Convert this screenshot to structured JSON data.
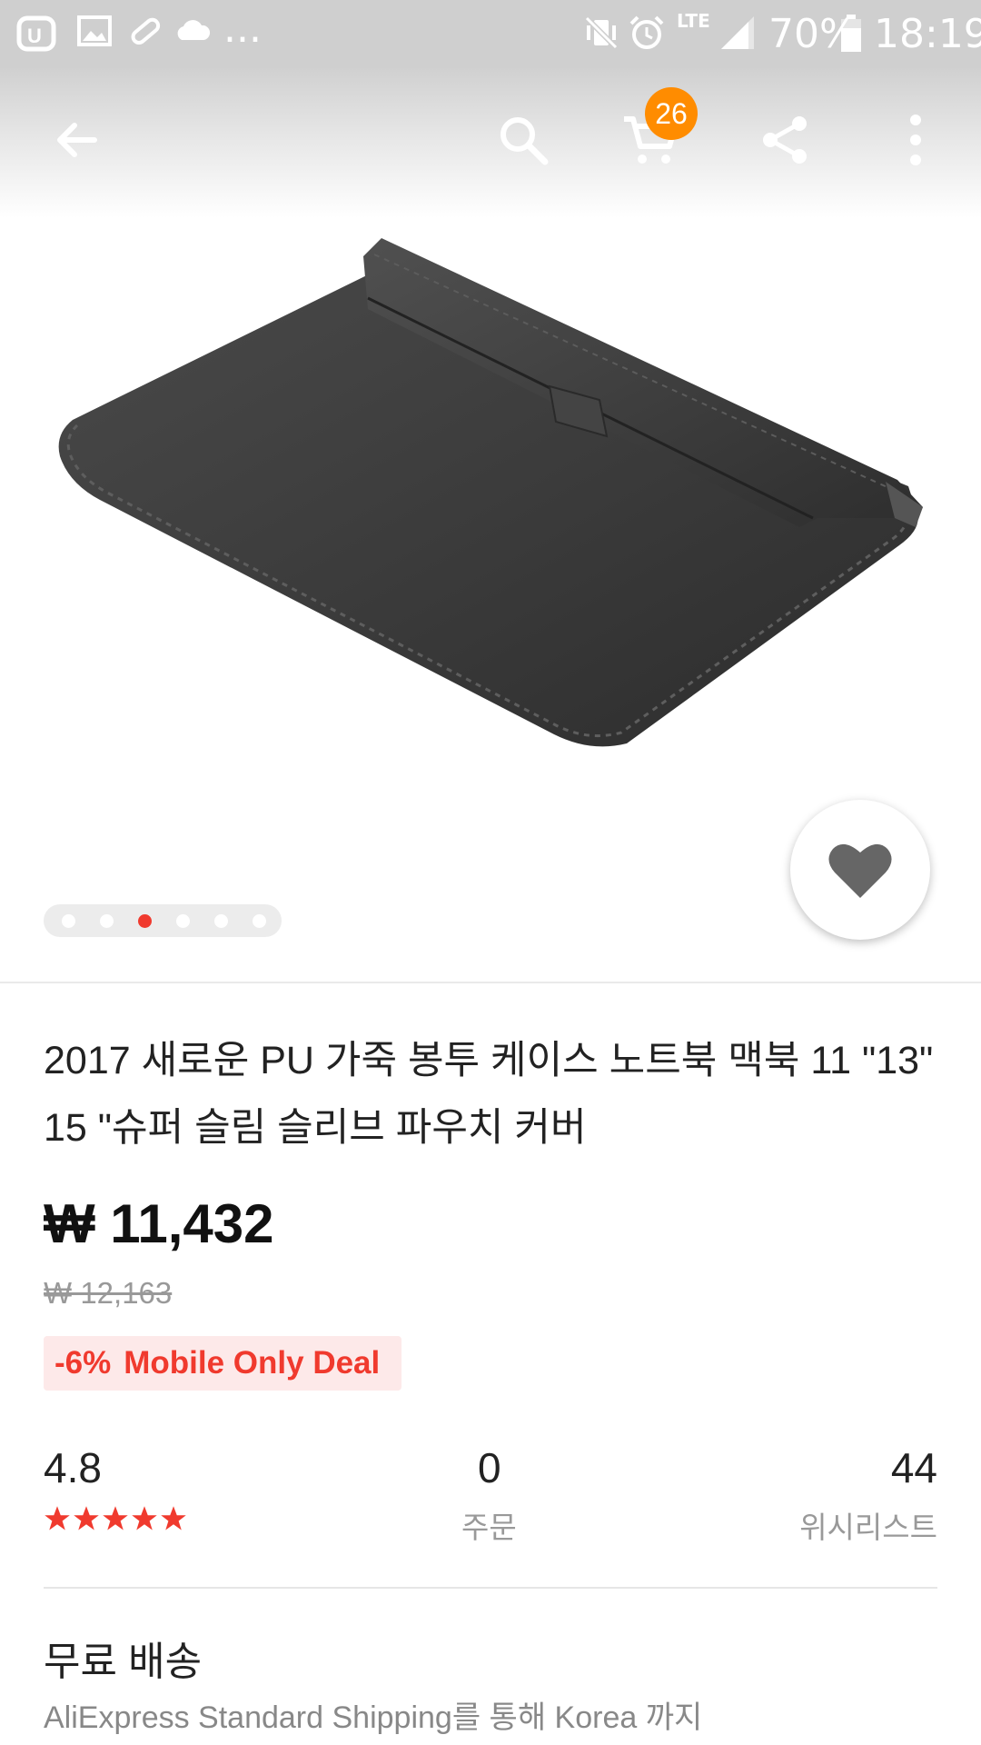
{
  "status_bar": {
    "time": "18:19",
    "battery": "70%",
    "network": "LTE",
    "more": "...",
    "icons": [
      "u-plus-icon",
      "image-icon",
      "pill-icon",
      "cloud-icon",
      "vibrate-mute-icon",
      "alarm-icon",
      "lte-icon",
      "signal-icon",
      "battery-icon"
    ]
  },
  "toolbar": {
    "cart_count": "26",
    "icons": [
      "back-arrow-icon",
      "search-icon",
      "cart-icon",
      "share-icon",
      "more-vert-icon"
    ]
  },
  "gallery": {
    "total": 6,
    "active_index": 2
  },
  "product": {
    "title": "2017 새로운 PU 가죽 봉투 케이스 노트북 맥북 11 \"13\" 15 \"슈퍼 슬림 슬리브 파우치 커버",
    "price": "₩ 11,432",
    "original_price": "₩ 12,163",
    "discount": "-6%",
    "deal_label": "Mobile Only Deal"
  },
  "stats": {
    "rating": "4.8",
    "star_count": 5,
    "orders_value": "0",
    "orders_label": "주문",
    "wishlist_value": "44",
    "wishlist_label": "위시리스트"
  },
  "shipping": {
    "title": "무료 배송",
    "subtitle": "AliExpress Standard Shipping를 통해 Korea 까지"
  },
  "colors": {
    "accent": "#f03a2e",
    "badge": "#ff8c00",
    "deal_bg": "#fde9e9"
  }
}
